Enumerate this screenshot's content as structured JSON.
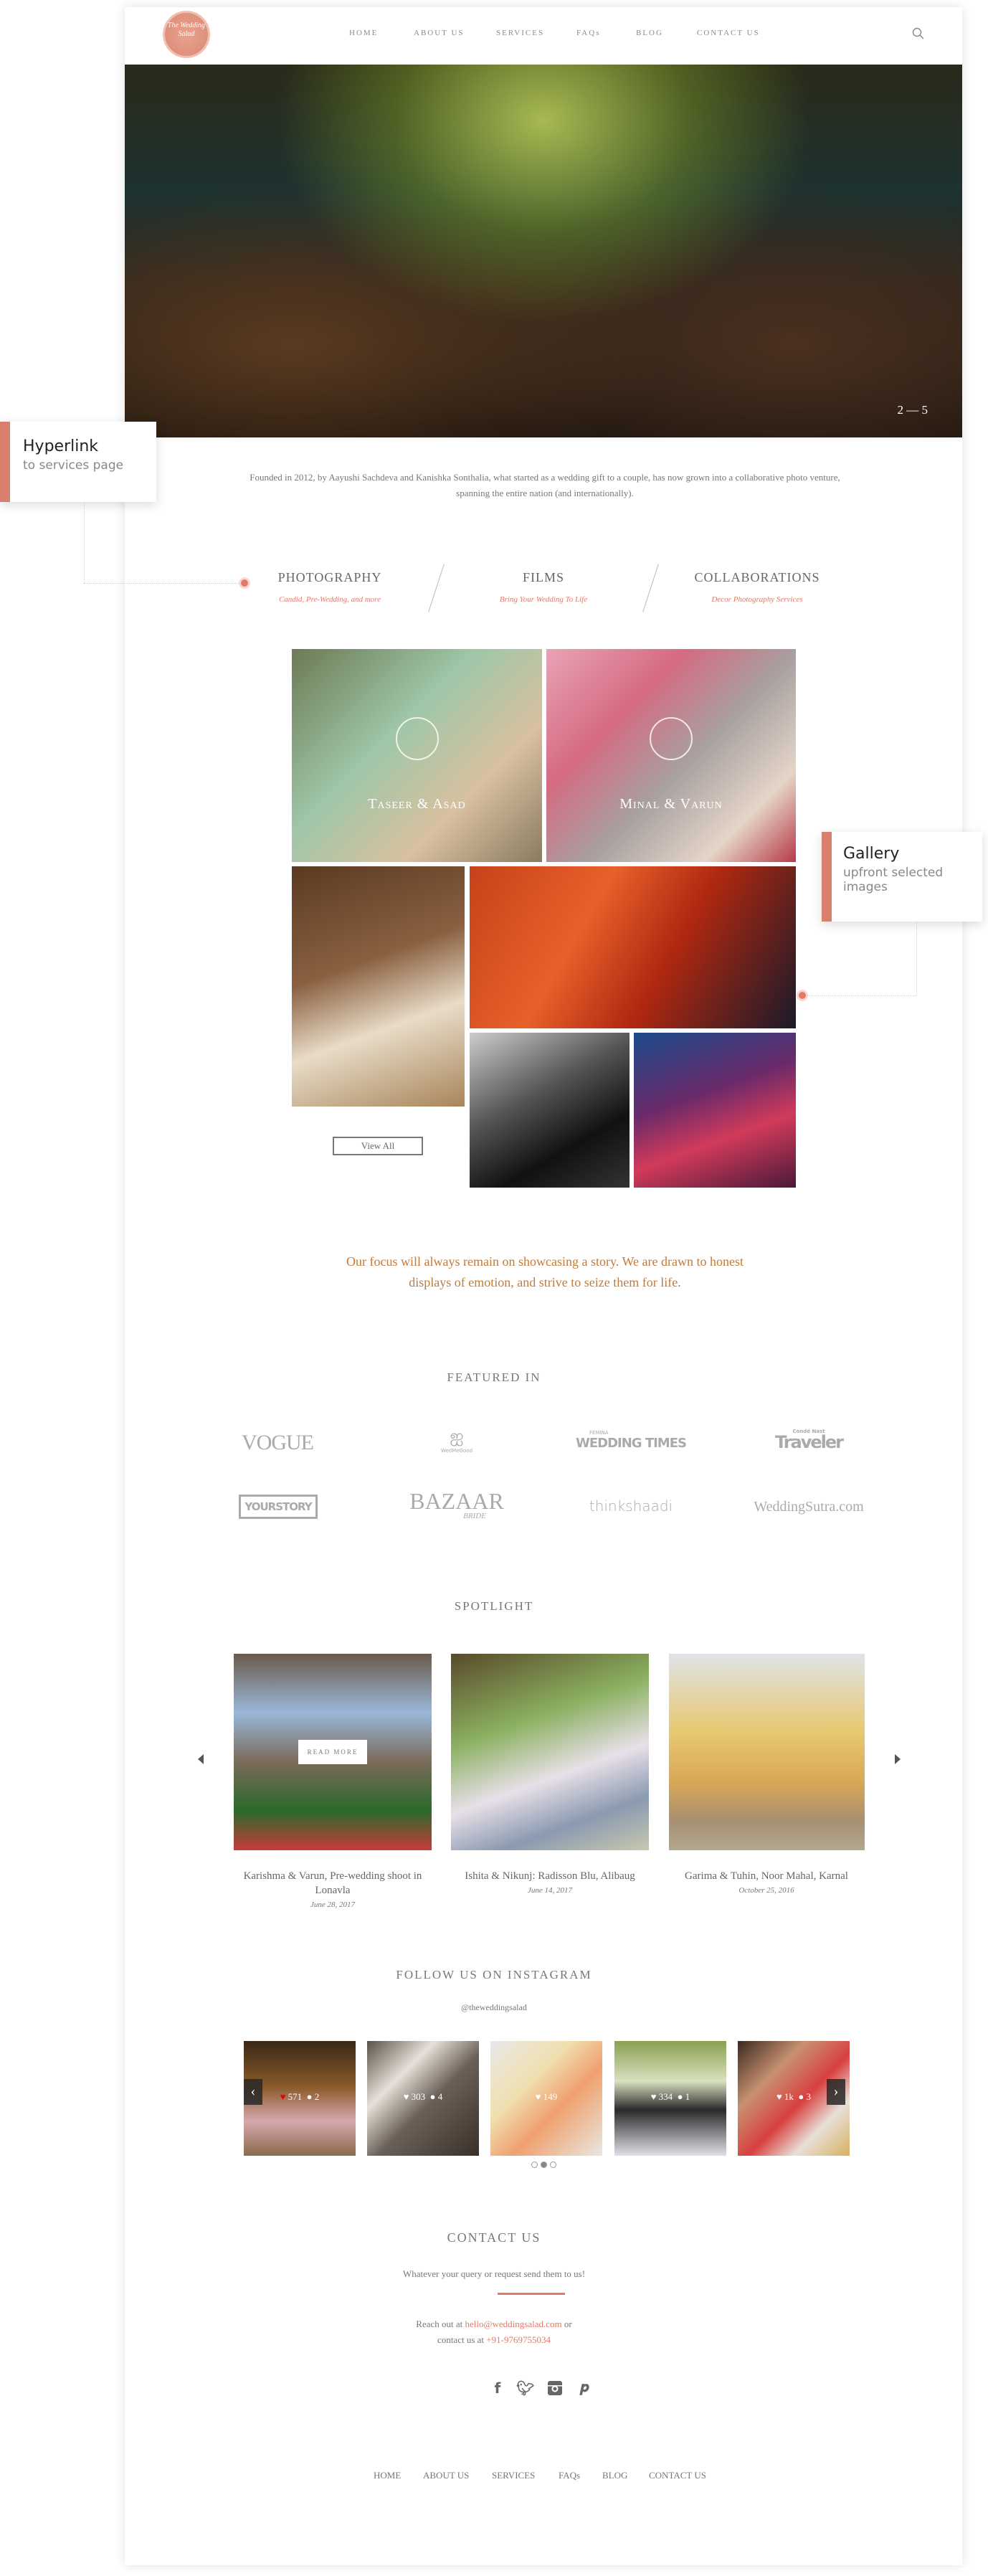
{
  "header": {
    "logo_text": "The Wedding Salad",
    "nav": [
      "HOME",
      "ABOUT US",
      "SERVICES",
      "FAQs",
      "BLOG",
      "CONTACT US"
    ],
    "search_icon": "search-icon"
  },
  "hero": {
    "counter": "2 — 5"
  },
  "annotations": {
    "hyperlink": {
      "title": "Hyperlink",
      "subtitle": "to services page"
    },
    "gallery": {
      "title": "Gallery",
      "subtitle": "upfront selected images"
    },
    "accent": "#d97f6e"
  },
  "intro": "Founded in 2012, by Aayushi Sachdeva and Kanishka Sonthalia, what started as a wedding gift to a couple, has now grown into a collaborative photo venture, spanning the entire nation (and internationally).",
  "services": [
    {
      "title": "PHOTOGRAPHY",
      "subtitle": "Candid, Pre-Wedding, and more"
    },
    {
      "title": "FILMS",
      "subtitle": "Bring Your Wedding To Life"
    },
    {
      "title": "COLLABORATIONS",
      "subtitle": "Decor Photography Services"
    }
  ],
  "gallery": {
    "labels": [
      "Taseer & Asad",
      "Minal & Varun"
    ],
    "view_all": "View All"
  },
  "focus": "Our focus will always remain on showcasing a story. We are drawn to honest displays of emotion, and strive to seize them for life.",
  "featured": {
    "title": "FEATURED IN",
    "logos": [
      "VOGUE",
      "WedMeGood",
      "FEMINA",
      "WEDDING TIMES",
      "Condé Nast",
      "Traveler",
      "YOURSTORY",
      "BAZAAR",
      "BRIDE",
      "thinkshaadi",
      "WeddingSutra.com"
    ]
  },
  "spotlight": {
    "title": "SPOTLIGHT",
    "read_more": "READ MORE",
    "items": [
      {
        "title": "Karishma & Varun, Pre-wedding shoot in Lonavla",
        "date": "June 28, 2017"
      },
      {
        "title": "Ishita & Nikunj: Radisson Blu, Alibaug",
        "date": "June 14, 2017"
      },
      {
        "title": "Garima & Tuhin, Noor Mahal, Karnal",
        "date": "October 25, 2016"
      }
    ]
  },
  "instagram": {
    "title": "FOLLOW US ON INSTAGRAM",
    "handle": "@theweddingsalad",
    "items": [
      {
        "likes": "571",
        "comments": "2"
      },
      {
        "likes": "303",
        "comments": "4"
      },
      {
        "likes": "149",
        "comments": ""
      },
      {
        "likes": "334",
        "comments": "1"
      },
      {
        "likes": "1k",
        "comments": "3"
      }
    ],
    "active_page": 2,
    "pages": 3
  },
  "contact": {
    "title": "CONTACT US",
    "subtitle": "Whatever your query or request send them to us!",
    "reach_prefix": "Reach out at ",
    "email": "hello@weddingsalad.com",
    "or": " or",
    "contact_prefix": "contact us at ",
    "phone": "+91-9769755034",
    "social": [
      "facebook-icon",
      "twitter-icon",
      "instagram-icon",
      "pinterest-icon"
    ]
  },
  "footer": {
    "nav": [
      "HOME",
      "ABOUT US",
      "SERVICES",
      "FAQs",
      "BLOG",
      "CONTACT US"
    ]
  }
}
